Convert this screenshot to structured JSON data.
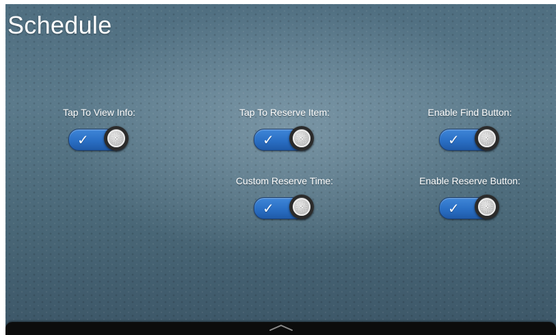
{
  "page": {
    "title": "Schedule"
  },
  "settings": [
    {
      "label": "Tap To View Info:",
      "enabled": true,
      "icon": "check-icon"
    },
    {
      "label": "Tap To Reserve Item:",
      "enabled": true,
      "icon": "check-icon"
    },
    {
      "label": "Enable Find Button:",
      "enabled": true,
      "icon": "check-icon"
    },
    {
      "label": "Custom Reserve Time:",
      "enabled": true,
      "icon": "check-icon"
    },
    {
      "label": "Enable Reserve Button:",
      "enabled": true,
      "icon": "check-icon"
    }
  ],
  "toggle": {
    "check_glyph": "✓",
    "track_color": "#2a6fc4"
  },
  "bottom_bar": {
    "handle_icon": "chevron-up-icon"
  }
}
